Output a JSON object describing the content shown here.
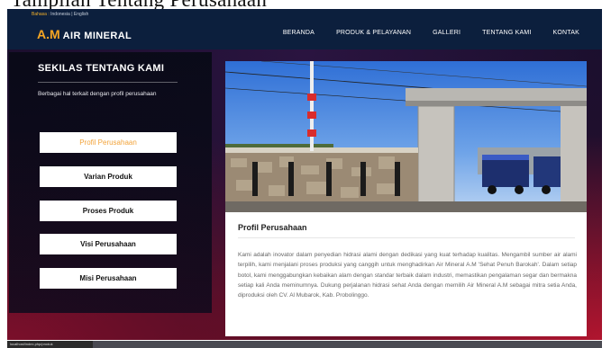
{
  "caption": {
    "text": "Tampilan Tentang Perusahaan"
  },
  "header": {
    "language": {
      "label": "Bahasa :",
      "options": "Indonesia | English"
    },
    "logo": {
      "mark": "A.M",
      "text": "AIR MINERAL"
    },
    "nav": [
      {
        "label": "BERANDA"
      },
      {
        "label": "PRODUK & PELAYANAN"
      },
      {
        "label": "GALLERI"
      },
      {
        "label": "TENTANG KAMI"
      },
      {
        "label": "KONTAK"
      }
    ]
  },
  "sidebar": {
    "title": "SEKILAS TENTANG KAMI",
    "subtitle": "Berbagai hal terkait dengan profil perusahaan",
    "items": [
      {
        "label": "Profil Perusahaan",
        "active": true
      },
      {
        "label": "Varian Produk",
        "active": false
      },
      {
        "label": "Proses Produk",
        "active": false
      },
      {
        "label": "Visi Perusahaan",
        "active": false
      },
      {
        "label": "Misi Perusahaan",
        "active": false
      }
    ]
  },
  "content": {
    "title": "Profil Perusahaan",
    "body": "Kami adalah inovator dalam penyedian hidrasi alami dengan dedikasi yang kuat terhadap kualitas. Mengambil sumber air alami terpilih, kami menjalani proses produksi yang canggih untuk menghadirkan Air Mineral A.M 'Sehat Penuh Barokah'. Dalam setiap botol, kami menggabungkan kebaikan alam dengan standar terbaik dalam industri, memastikan pengalaman segar dan bermakna setiap kali Anda meminumnya. Dukung perjalanan hidrasi sehat Anda dengan memilih Air Mineral A.M sebagai mitra setia Anda, diproduksi oleh CV. Al Mubarok, Kab. Probolinggo."
  },
  "status_bar": {
    "text": "localhost/index.php/produk"
  },
  "colors": {
    "header_bg": "#0c1f3d",
    "accent": "#f6a623",
    "active_item": "#f2a33a",
    "hero_dark": "#1b0f2e",
    "hero_red": "#b0152f"
  }
}
